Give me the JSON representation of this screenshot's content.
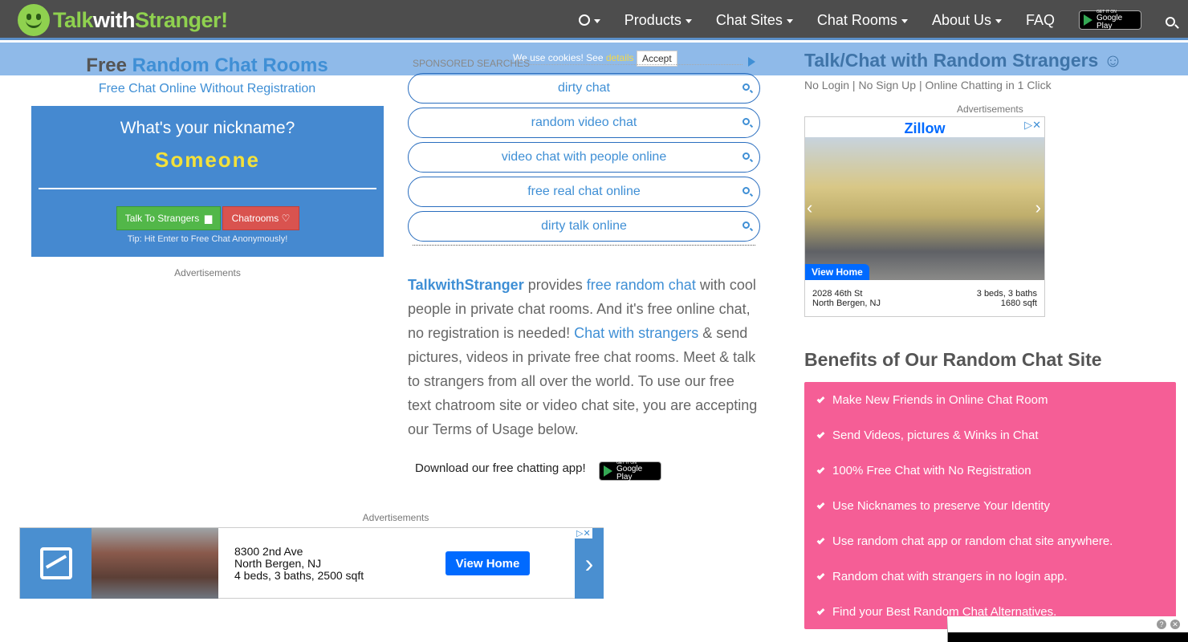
{
  "nav": {
    "logo": {
      "p1": "Talk",
      "p2": "with",
      "p3": "Stranger!"
    },
    "items": [
      "Products",
      "Chat Sites",
      "Chat Rooms",
      "About Us"
    ],
    "faq": "FAQ",
    "gplay_small": "GET IT ON",
    "gplay_large": "Google Play"
  },
  "cookie": {
    "text": "We use cookies! See",
    "link": "details",
    "accept": "Accept"
  },
  "hero": {
    "title_free": "Free",
    "title_rest": "Random Chat Rooms",
    "subtitle": "Free Chat Online Without Registration",
    "question": "What's your nickname?",
    "nickname": "Someone",
    "talk_button": "Talk To Strangers",
    "rooms_button": "Chatrooms",
    "tip": "Tip: Hit Enter to Free Chat Anonymously!",
    "ads_label": "Advertisements"
  },
  "sponsored": {
    "header": "SPONSORED SEARCHES",
    "items": [
      "dirty chat",
      "random video chat",
      "video chat with people online",
      "free real chat online",
      "dirty talk online"
    ]
  },
  "intro": {
    "brand": "TalkwithStranger",
    "t1": " provides ",
    "link1": "free random chat",
    "t2": " with cool people in private chat rooms. And it's free online chat, no registration is needed! ",
    "link2": "Chat with strangers",
    "t3": " & send pictures, videos in private free chat rooms. Meet & talk to strangers from all over the world. To use our free text chatroom site or video chat site, you are accepting our Terms of Usage below."
  },
  "download": {
    "text": "Download our free chatting app!"
  },
  "bottom_ad": {
    "label": "Advertisements",
    "line1": "8300 2nd Ave",
    "line2": "North Bergen, NJ",
    "line3": "4 beds, 3 baths, 2500 sqft",
    "button": "View Home"
  },
  "right": {
    "title": "Talk/Chat with Random Strangers ☺",
    "subtitle": "No Login | No Sign Up | Online Chatting in 1 Click",
    "ads_label": "Advertisements",
    "zillow": {
      "brand": "Zillow",
      "button": "View Home",
      "addr1": "2028 46th St",
      "addr2": "North Bergen, NJ",
      "beds": "3 beds, 3 baths",
      "sqft": "1680 sqft"
    },
    "benefits_title": "Benefits of Our Random Chat Site",
    "benefits": [
      "Make New Friends in Online Chat Room",
      "Send Videos, pictures & Winks in Chat",
      "100% Free Chat with No Registration",
      "Use Nicknames to preserve Your Identity",
      "Use random chat app or random chat site anywhere.",
      "Random chat with strangers in no login app.",
      "Find your Best Random Chat Alternatives."
    ]
  }
}
